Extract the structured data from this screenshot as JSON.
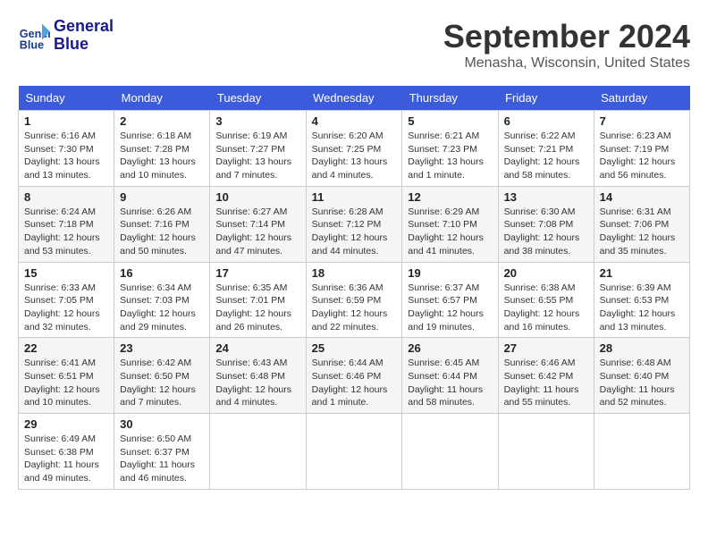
{
  "header": {
    "logo_line1": "General",
    "logo_line2": "Blue",
    "month": "September 2024",
    "location": "Menasha, Wisconsin, United States"
  },
  "weekdays": [
    "Sunday",
    "Monday",
    "Tuesday",
    "Wednesday",
    "Thursday",
    "Friday",
    "Saturday"
  ],
  "weeks": [
    [
      {
        "day": "1",
        "sunrise": "Sunrise: 6:16 AM",
        "sunset": "Sunset: 7:30 PM",
        "daylight": "Daylight: 13 hours and 13 minutes."
      },
      {
        "day": "2",
        "sunrise": "Sunrise: 6:18 AM",
        "sunset": "Sunset: 7:28 PM",
        "daylight": "Daylight: 13 hours and 10 minutes."
      },
      {
        "day": "3",
        "sunrise": "Sunrise: 6:19 AM",
        "sunset": "Sunset: 7:27 PM",
        "daylight": "Daylight: 13 hours and 7 minutes."
      },
      {
        "day": "4",
        "sunrise": "Sunrise: 6:20 AM",
        "sunset": "Sunset: 7:25 PM",
        "daylight": "Daylight: 13 hours and 4 minutes."
      },
      {
        "day": "5",
        "sunrise": "Sunrise: 6:21 AM",
        "sunset": "Sunset: 7:23 PM",
        "daylight": "Daylight: 13 hours and 1 minute."
      },
      {
        "day": "6",
        "sunrise": "Sunrise: 6:22 AM",
        "sunset": "Sunset: 7:21 PM",
        "daylight": "Daylight: 12 hours and 58 minutes."
      },
      {
        "day": "7",
        "sunrise": "Sunrise: 6:23 AM",
        "sunset": "Sunset: 7:19 PM",
        "daylight": "Daylight: 12 hours and 56 minutes."
      }
    ],
    [
      {
        "day": "8",
        "sunrise": "Sunrise: 6:24 AM",
        "sunset": "Sunset: 7:18 PM",
        "daylight": "Daylight: 12 hours and 53 minutes."
      },
      {
        "day": "9",
        "sunrise": "Sunrise: 6:26 AM",
        "sunset": "Sunset: 7:16 PM",
        "daylight": "Daylight: 12 hours and 50 minutes."
      },
      {
        "day": "10",
        "sunrise": "Sunrise: 6:27 AM",
        "sunset": "Sunset: 7:14 PM",
        "daylight": "Daylight: 12 hours and 47 minutes."
      },
      {
        "day": "11",
        "sunrise": "Sunrise: 6:28 AM",
        "sunset": "Sunset: 7:12 PM",
        "daylight": "Daylight: 12 hours and 44 minutes."
      },
      {
        "day": "12",
        "sunrise": "Sunrise: 6:29 AM",
        "sunset": "Sunset: 7:10 PM",
        "daylight": "Daylight: 12 hours and 41 minutes."
      },
      {
        "day": "13",
        "sunrise": "Sunrise: 6:30 AM",
        "sunset": "Sunset: 7:08 PM",
        "daylight": "Daylight: 12 hours and 38 minutes."
      },
      {
        "day": "14",
        "sunrise": "Sunrise: 6:31 AM",
        "sunset": "Sunset: 7:06 PM",
        "daylight": "Daylight: 12 hours and 35 minutes."
      }
    ],
    [
      {
        "day": "15",
        "sunrise": "Sunrise: 6:33 AM",
        "sunset": "Sunset: 7:05 PM",
        "daylight": "Daylight: 12 hours and 32 minutes."
      },
      {
        "day": "16",
        "sunrise": "Sunrise: 6:34 AM",
        "sunset": "Sunset: 7:03 PM",
        "daylight": "Daylight: 12 hours and 29 minutes."
      },
      {
        "day": "17",
        "sunrise": "Sunrise: 6:35 AM",
        "sunset": "Sunset: 7:01 PM",
        "daylight": "Daylight: 12 hours and 26 minutes."
      },
      {
        "day": "18",
        "sunrise": "Sunrise: 6:36 AM",
        "sunset": "Sunset: 6:59 PM",
        "daylight": "Daylight: 12 hours and 22 minutes."
      },
      {
        "day": "19",
        "sunrise": "Sunrise: 6:37 AM",
        "sunset": "Sunset: 6:57 PM",
        "daylight": "Daylight: 12 hours and 19 minutes."
      },
      {
        "day": "20",
        "sunrise": "Sunrise: 6:38 AM",
        "sunset": "Sunset: 6:55 PM",
        "daylight": "Daylight: 12 hours and 16 minutes."
      },
      {
        "day": "21",
        "sunrise": "Sunrise: 6:39 AM",
        "sunset": "Sunset: 6:53 PM",
        "daylight": "Daylight: 12 hours and 13 minutes."
      }
    ],
    [
      {
        "day": "22",
        "sunrise": "Sunrise: 6:41 AM",
        "sunset": "Sunset: 6:51 PM",
        "daylight": "Daylight: 12 hours and 10 minutes."
      },
      {
        "day": "23",
        "sunrise": "Sunrise: 6:42 AM",
        "sunset": "Sunset: 6:50 PM",
        "daylight": "Daylight: 12 hours and 7 minutes."
      },
      {
        "day": "24",
        "sunrise": "Sunrise: 6:43 AM",
        "sunset": "Sunset: 6:48 PM",
        "daylight": "Daylight: 12 hours and 4 minutes."
      },
      {
        "day": "25",
        "sunrise": "Sunrise: 6:44 AM",
        "sunset": "Sunset: 6:46 PM",
        "daylight": "Daylight: 12 hours and 1 minute."
      },
      {
        "day": "26",
        "sunrise": "Sunrise: 6:45 AM",
        "sunset": "Sunset: 6:44 PM",
        "daylight": "Daylight: 11 hours and 58 minutes."
      },
      {
        "day": "27",
        "sunrise": "Sunrise: 6:46 AM",
        "sunset": "Sunset: 6:42 PM",
        "daylight": "Daylight: 11 hours and 55 minutes."
      },
      {
        "day": "28",
        "sunrise": "Sunrise: 6:48 AM",
        "sunset": "Sunset: 6:40 PM",
        "daylight": "Daylight: 11 hours and 52 minutes."
      }
    ],
    [
      {
        "day": "29",
        "sunrise": "Sunrise: 6:49 AM",
        "sunset": "Sunset: 6:38 PM",
        "daylight": "Daylight: 11 hours and 49 minutes."
      },
      {
        "day": "30",
        "sunrise": "Sunrise: 6:50 AM",
        "sunset": "Sunset: 6:37 PM",
        "daylight": "Daylight: 11 hours and 46 minutes."
      },
      null,
      null,
      null,
      null,
      null
    ]
  ]
}
